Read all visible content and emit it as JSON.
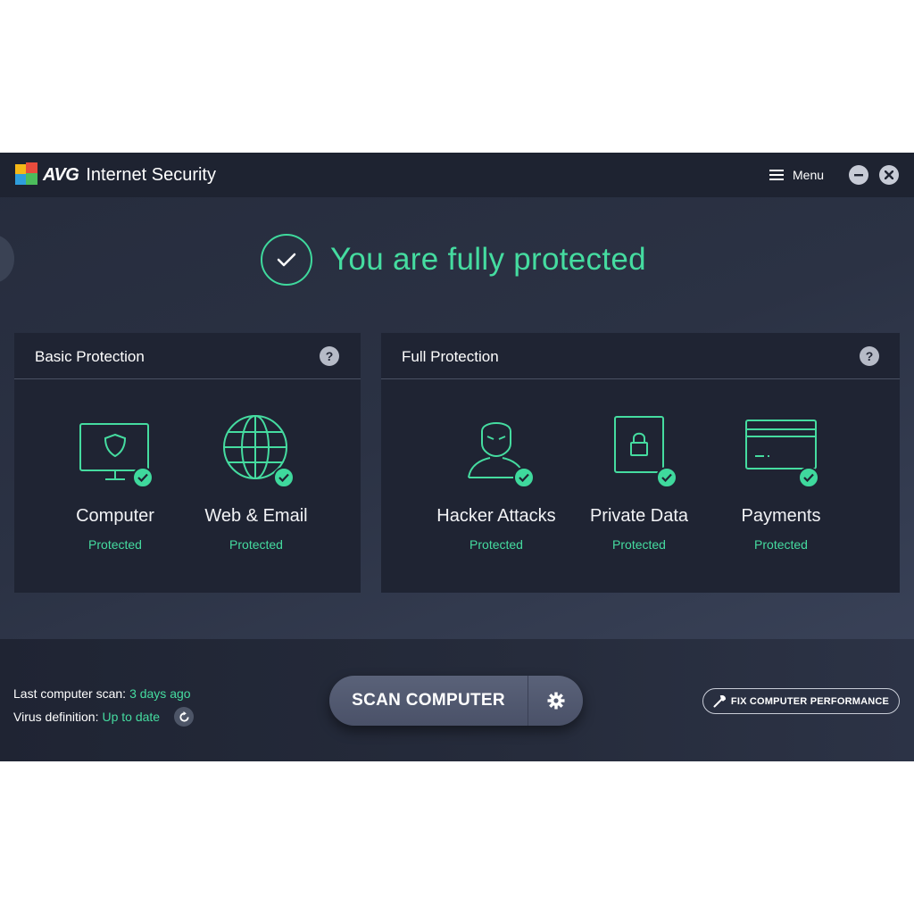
{
  "app": {
    "brand": "AVG",
    "product": "Internet Security",
    "menu_label": "Menu"
  },
  "status": {
    "headline": "You are fully protected"
  },
  "panels": [
    {
      "title": "Basic Protection",
      "features": [
        {
          "label": "Computer",
          "status": "Protected",
          "icon": "monitor-shield-icon"
        },
        {
          "label": "Web & Email",
          "status": "Protected",
          "icon": "globe-icon"
        }
      ]
    },
    {
      "title": "Full Protection",
      "features": [
        {
          "label": "Hacker Attacks",
          "status": "Protected",
          "icon": "hacker-icon"
        },
        {
          "label": "Private Data",
          "status": "Protected",
          "icon": "padlock-document-icon"
        },
        {
          "label": "Payments",
          "status": "Protected",
          "icon": "credit-card-icon"
        }
      ]
    }
  ],
  "footer": {
    "last_scan_label": "Last computer scan:",
    "last_scan_value": "3 days ago",
    "virus_def_label": "Virus definition:",
    "virus_def_value": "Up to date",
    "scan_button": "SCAN COMPUTER",
    "fix_button": "FIX COMPUTER PERFORMANCE"
  },
  "colors": {
    "accent_green": "#45dca0",
    "window_bg": "#2b3244",
    "titlebar_bg": "#1e2331",
    "panel_bg": "#1f2433"
  }
}
